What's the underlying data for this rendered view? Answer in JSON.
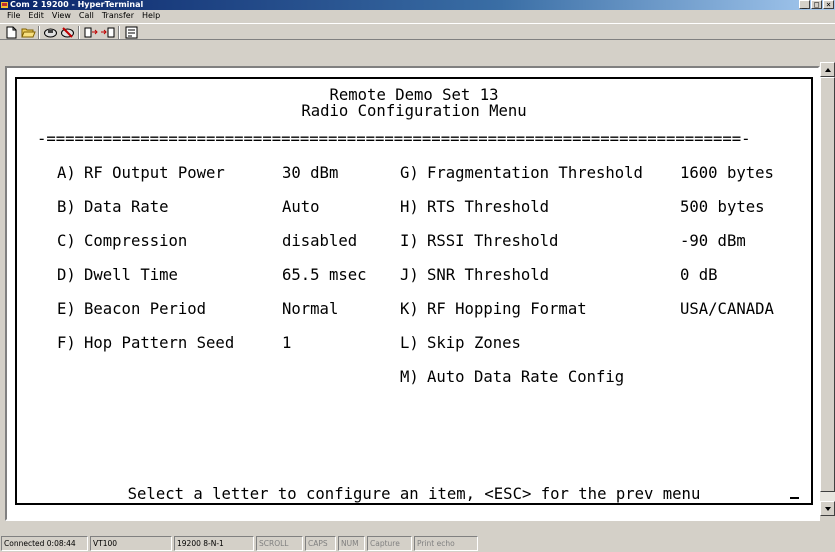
{
  "window": {
    "title": "Com 2 19200 - HyperTerminal",
    "controls": {
      "minimize": "_",
      "maximize": "□",
      "close": "×"
    }
  },
  "menu": [
    "File",
    "Edit",
    "View",
    "Call",
    "Transfer",
    "Help"
  ],
  "toolbar": {
    "buttons": [
      "new-document-icon",
      "open-folder-icon",
      "connect-phone-icon",
      "disconnect-phone-icon",
      "send-file-icon",
      "receive-file-icon",
      "properties-icon"
    ]
  },
  "terminal": {
    "title_line1": "Remote Demo Set 13",
    "title_line2": "Radio Configuration Menu",
    "divider": "-==========================================================================-",
    "left_options": [
      {
        "key": "A)",
        "label": "RF Output Power",
        "value": "30 dBm"
      },
      {
        "key": "B)",
        "label": "Data Rate",
        "value": "Auto"
      },
      {
        "key": "C)",
        "label": "Compression",
        "value": "disabled"
      },
      {
        "key": "D)",
        "label": "Dwell Time",
        "value": "65.5 msec"
      },
      {
        "key": "E)",
        "label": "Beacon Period",
        "value": "Normal"
      },
      {
        "key": "F)",
        "label": "Hop Pattern Seed",
        "value": "1"
      }
    ],
    "right_options": [
      {
        "key": "G)",
        "label": "Fragmentation Threshold",
        "value": "1600 bytes"
      },
      {
        "key": "H)",
        "label": "RTS Threshold",
        "value": "500 bytes"
      },
      {
        "key": "I)",
        "label": "RSSI Threshold",
        "value": "-90 dBm"
      },
      {
        "key": "J)",
        "label": "SNR Threshold",
        "value": "0 dB"
      },
      {
        "key": "K)",
        "label": "RF Hopping Format",
        "value": "USA/CANADA"
      },
      {
        "key": "L)",
        "label": "Skip Zones",
        "value": ""
      },
      {
        "key": "M)",
        "label": "Auto Data Rate Config",
        "value": ""
      }
    ],
    "footer": "Select a letter to configure an item, <ESC> for the prev menu"
  },
  "status": {
    "connected": "Connected 0:08:44",
    "emulation": "VT100",
    "port_settings": "19200 8-N-1",
    "scroll": "SCROLL",
    "caps": "CAPS",
    "num": "NUM",
    "capture": "Capture",
    "print_echo": "Print echo"
  },
  "colors": {
    "title_gradient_start": "#0a246a",
    "title_gradient_end": "#a6caf0",
    "chrome": "#d4d0c8",
    "terminal_bg": "#ffffff",
    "terminal_text": "#000000"
  }
}
